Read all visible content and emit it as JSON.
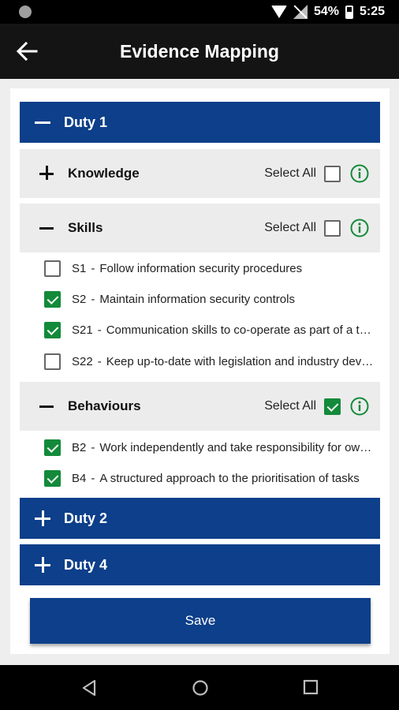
{
  "status": {
    "battery": "54%",
    "time": "5:25"
  },
  "appbar": {
    "title": "Evidence Mapping"
  },
  "duties": [
    {
      "label": "Duty 1",
      "expanded": true
    },
    {
      "label": "Duty 2",
      "expanded": false
    },
    {
      "label": "Duty 4",
      "expanded": false
    }
  ],
  "groups": [
    {
      "label": "Knowledge",
      "expanded": false,
      "select_all_label": "Select All",
      "select_all_checked": false
    },
    {
      "label": "Skills",
      "expanded": true,
      "select_all_label": "Select All",
      "select_all_checked": false
    },
    {
      "label": "Behaviours",
      "expanded": true,
      "select_all_label": "Select All",
      "select_all_checked": true
    }
  ],
  "skills": [
    {
      "code": "S1",
      "text": "Follow information security procedures",
      "checked": false
    },
    {
      "code": "S2",
      "text": "Maintain information security controls",
      "checked": true
    },
    {
      "code": "S21",
      "text": "Communication skills to co-operate as part of a team",
      "checked": true
    },
    {
      "code": "S22",
      "text": "Keep up-to-date with legislation and industry developments",
      "checked": false
    }
  ],
  "behaviours": [
    {
      "code": "B2",
      "text": "Work independently and take responsibility for own actions",
      "checked": true
    },
    {
      "code": "B4",
      "text": "A structured approach to the prioritisation of tasks",
      "checked": true
    }
  ],
  "separator": "-",
  "save_label": "Save",
  "colors": {
    "primary": "#0d3f8a",
    "check": "#138a3a",
    "info": "#138a3a"
  }
}
